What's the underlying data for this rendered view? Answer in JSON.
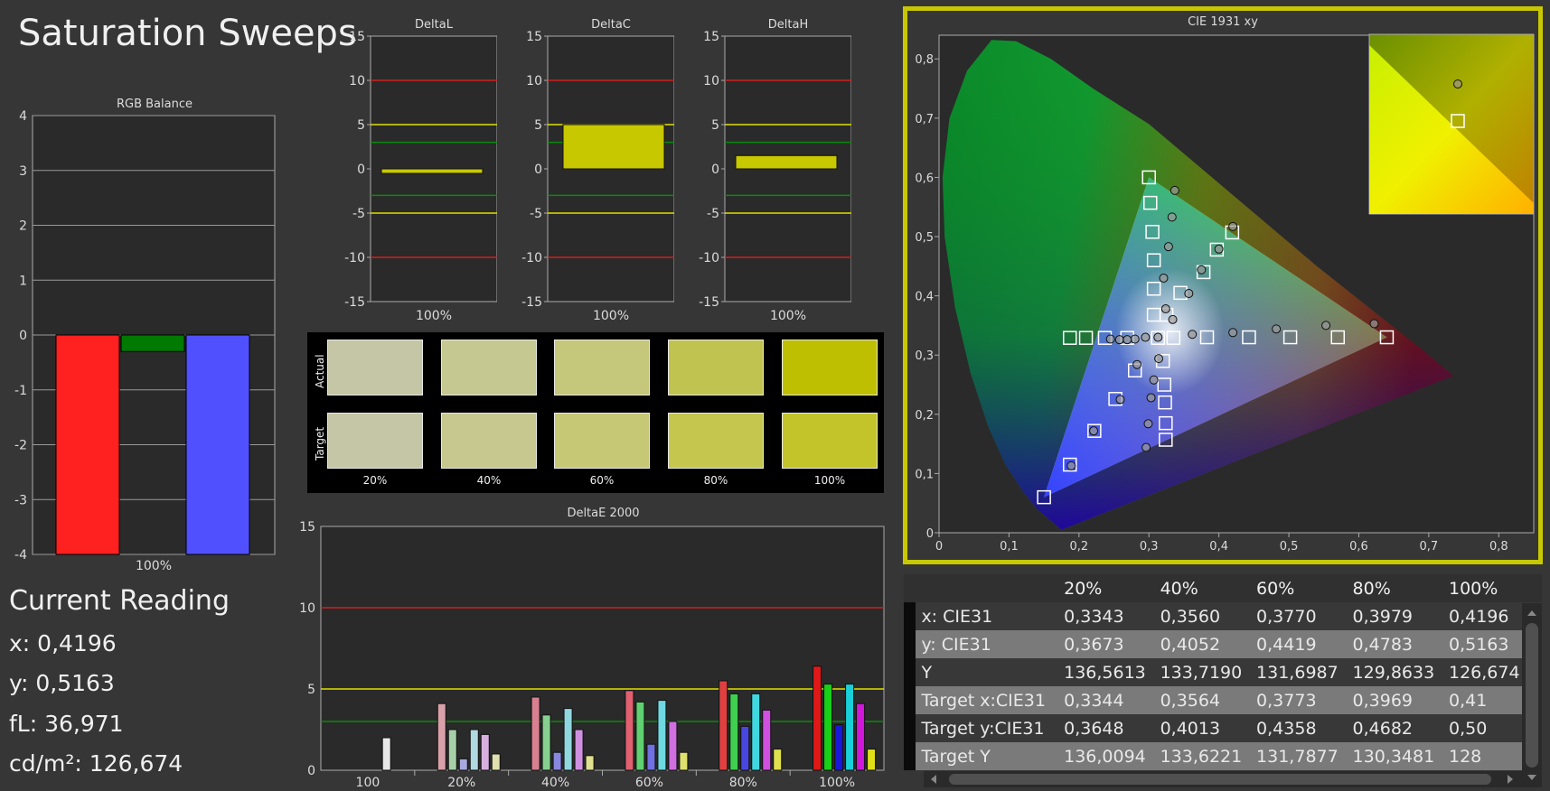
{
  "page": {
    "title": "Saturation Sweeps"
  },
  "colors": {
    "red": "#ff2020",
    "green": "#007a00",
    "blue": "#5050ff",
    "limit_red": "#d02020",
    "limit_yellow": "#e0e000",
    "limit_green": "#0a8a0a",
    "frame_yellow": "#c8c800"
  },
  "rgb_balance": {
    "title": "RGB Balance",
    "chart_data": {
      "type": "bar",
      "categories": [
        "100%"
      ],
      "series": [
        {
          "values": [
            -4
          ]
        },
        {
          "values": [
            -0.3
          ]
        },
        {
          "values": [
            -4
          ]
        }
      ],
      "ylim": [
        -4,
        4
      ],
      "ticks": [
        "4",
        "3",
        "2",
        "1",
        "0",
        "-1",
        "-2",
        "-3",
        "-4"
      ]
    }
  },
  "delta_charts": [
    {
      "title": "DeltaL",
      "category": "100%",
      "value": -0.3,
      "bar_base": 0,
      "ylim": [
        -15,
        15
      ]
    },
    {
      "title": "DeltaC",
      "category": "100%",
      "value": 5,
      "bar_base": 0,
      "ylim": [
        -15,
        15
      ]
    },
    {
      "title": "DeltaH",
      "category": "100%",
      "value": 1.5,
      "bar_base": 0,
      "ylim": [
        -15,
        15
      ]
    }
  ],
  "delta_ticks": [
    "15",
    "10",
    "5",
    "0",
    "-5",
    "-10",
    "-15"
  ],
  "swatches": {
    "actual_label": "Actual",
    "target_label": "Target",
    "labels": [
      "20%",
      "40%",
      "60%",
      "80%",
      "100%"
    ],
    "actual_colors": [
      "#c5c6a6",
      "#c6c891",
      "#c5c77a",
      "#c1c351",
      "#bdbf00"
    ],
    "target_colors": [
      "#c5c6a6",
      "#c7c88f",
      "#c6c876",
      "#c4c64e",
      "#c2c42a"
    ]
  },
  "deltae": {
    "title": "DeltaE 2000",
    "ticks": [
      "15",
      "10",
      "5",
      "0"
    ],
    "chart_data": {
      "type": "bar",
      "ylim": [
        0,
        15
      ],
      "categories": [
        "100",
        "20%",
        "40%",
        "60%",
        "80%",
        "100%"
      ],
      "groups": [
        [
          {
            "c": "#e8e8e8",
            "v": 2.0
          }
        ],
        [
          {
            "c": "#d8a0a8",
            "v": 4.1
          },
          {
            "c": "#a8d0a8",
            "v": 2.5
          },
          {
            "c": "#a8a8e0",
            "v": 0.7
          },
          {
            "c": "#b0d8e0",
            "v": 2.5
          },
          {
            "c": "#d8b0e0",
            "v": 2.2
          },
          {
            "c": "#e0e0b0",
            "v": 1.0
          }
        ],
        [
          {
            "c": "#d88090",
            "v": 4.5
          },
          {
            "c": "#88d090",
            "v": 3.4
          },
          {
            "c": "#8888e0",
            "v": 1.1
          },
          {
            "c": "#90d8e0",
            "v": 3.8
          },
          {
            "c": "#d090e0",
            "v": 2.5
          },
          {
            "c": "#e0e090",
            "v": 0.9
          }
        ],
        [
          {
            "c": "#e06070",
            "v": 4.9
          },
          {
            "c": "#60d070",
            "v": 4.2
          },
          {
            "c": "#7070e0",
            "v": 1.6
          },
          {
            "c": "#70d8e0",
            "v": 4.3
          },
          {
            "c": "#d070e0",
            "v": 3.0
          },
          {
            "c": "#e0e070",
            "v": 1.1
          }
        ],
        [
          {
            "c": "#e04040",
            "v": 5.5
          },
          {
            "c": "#40d050",
            "v": 4.7
          },
          {
            "c": "#4848e0",
            "v": 2.7
          },
          {
            "c": "#40d8e0",
            "v": 4.7
          },
          {
            "c": "#d050e0",
            "v": 3.7
          },
          {
            "c": "#e0e050",
            "v": 1.3
          }
        ],
        [
          {
            "c": "#e01818",
            "v": 6.4
          },
          {
            "c": "#18d018",
            "v": 5.3
          },
          {
            "c": "#1818d8",
            "v": 2.8
          },
          {
            "c": "#18d0d8",
            "v": 5.3
          },
          {
            "c": "#d018d8",
            "v": 4.1
          },
          {
            "c": "#e0e018",
            "v": 1.3
          }
        ]
      ]
    }
  },
  "cie": {
    "title": "CIE 1931 xy",
    "xticks": [
      "0",
      "0,1",
      "0,2",
      "0,3",
      "0,4",
      "0,5",
      "0,6",
      "0,7",
      "0,8"
    ],
    "yticks": [
      "0,8",
      "0,7",
      "0,6",
      "0,5",
      "0,4",
      "0,3",
      "0,2",
      "0,1",
      "0"
    ],
    "chart_data": {
      "type": "scatter",
      "xlim": [
        0,
        0.85
      ],
      "ylim": [
        0,
        0.84
      ],
      "gamut": [
        [
          0.64,
          0.33
        ],
        [
          0.3,
          0.6
        ],
        [
          0.15,
          0.06
        ]
      ],
      "targets": [
        [
          0.313,
          0.329
        ],
        [
          0.335,
          0.329
        ],
        [
          0.383,
          0.33
        ],
        [
          0.443,
          0.33
        ],
        [
          0.502,
          0.33
        ],
        [
          0.57,
          0.33
        ],
        [
          0.64,
          0.33
        ],
        [
          0.307,
          0.368
        ],
        [
          0.307,
          0.412
        ],
        [
          0.307,
          0.46
        ],
        [
          0.305,
          0.508
        ],
        [
          0.302,
          0.557
        ],
        [
          0.3,
          0.6
        ],
        [
          0.269,
          0.329
        ],
        [
          0.237,
          0.329
        ],
        [
          0.21,
          0.329
        ],
        [
          0.187,
          0.329
        ],
        [
          0.28,
          0.274
        ],
        [
          0.252,
          0.226
        ],
        [
          0.222,
          0.172
        ],
        [
          0.187,
          0.115
        ],
        [
          0.15,
          0.06
        ],
        [
          0.32,
          0.29
        ],
        [
          0.322,
          0.25
        ],
        [
          0.323,
          0.22
        ],
        [
          0.324,
          0.185
        ],
        [
          0.324,
          0.157
        ],
        [
          0.325,
          0.368
        ],
        [
          0.345,
          0.405
        ],
        [
          0.378,
          0.44
        ],
        [
          0.397,
          0.478
        ],
        [
          0.419,
          0.507
        ]
      ],
      "actual": [
        [
          0.313,
          0.33
        ],
        [
          0.362,
          0.335
        ],
        [
          0.42,
          0.338
        ],
        [
          0.482,
          0.344
        ],
        [
          0.553,
          0.35
        ],
        [
          0.622,
          0.353
        ],
        [
          0.334,
          0.36
        ],
        [
          0.324,
          0.378
        ],
        [
          0.321,
          0.43
        ],
        [
          0.328,
          0.483
        ],
        [
          0.333,
          0.533
        ],
        [
          0.337,
          0.578
        ],
        [
          0.295,
          0.33
        ],
        [
          0.28,
          0.327
        ],
        [
          0.269,
          0.326
        ],
        [
          0.258,
          0.326
        ],
        [
          0.245,
          0.327
        ],
        [
          0.283,
          0.284
        ],
        [
          0.259,
          0.225
        ],
        [
          0.221,
          0.172
        ],
        [
          0.189,
          0.113
        ],
        [
          0.314,
          0.294
        ],
        [
          0.307,
          0.258
        ],
        [
          0.303,
          0.228
        ],
        [
          0.299,
          0.184
        ],
        [
          0.296,
          0.144
        ],
        [
          0.357,
          0.404
        ],
        [
          0.375,
          0.444
        ],
        [
          0.4,
          0.479
        ],
        [
          0.42,
          0.517
        ]
      ]
    }
  },
  "table": {
    "headers": [
      "20%",
      "40%",
      "60%",
      "80%",
      "100%"
    ],
    "rows": [
      {
        "name": "x: CIE31",
        "values": [
          "0,3343",
          "0,3560",
          "0,3770",
          "0,3979",
          "0,4196"
        ]
      },
      {
        "name": "y: CIE31",
        "values": [
          "0,3673",
          "0,4052",
          "0,4419",
          "0,4783",
          "0,5163"
        ]
      },
      {
        "name": "Y",
        "values": [
          "136,5613",
          "133,7190",
          "131,6987",
          "129,8633",
          "126,674"
        ]
      },
      {
        "name": "Target x:CIE31",
        "values": [
          "0,3344",
          "0,3564",
          "0,3773",
          "0,3969",
          "0,41"
        ]
      },
      {
        "name": "Target y:CIE31",
        "values": [
          "0,3648",
          "0,4013",
          "0,4358",
          "0,4682",
          "0,50"
        ]
      },
      {
        "name": "Target Y",
        "values": [
          "136,0094",
          "133,6221",
          "131,7877",
          "130,3481",
          "128"
        ]
      }
    ]
  },
  "reading": {
    "heading": "Current Reading",
    "x": "x: 0,4196",
    "y": "y: 0,5163",
    "fl": "fL: 36,971",
    "cdm2": "cd/m²: 126,674"
  }
}
